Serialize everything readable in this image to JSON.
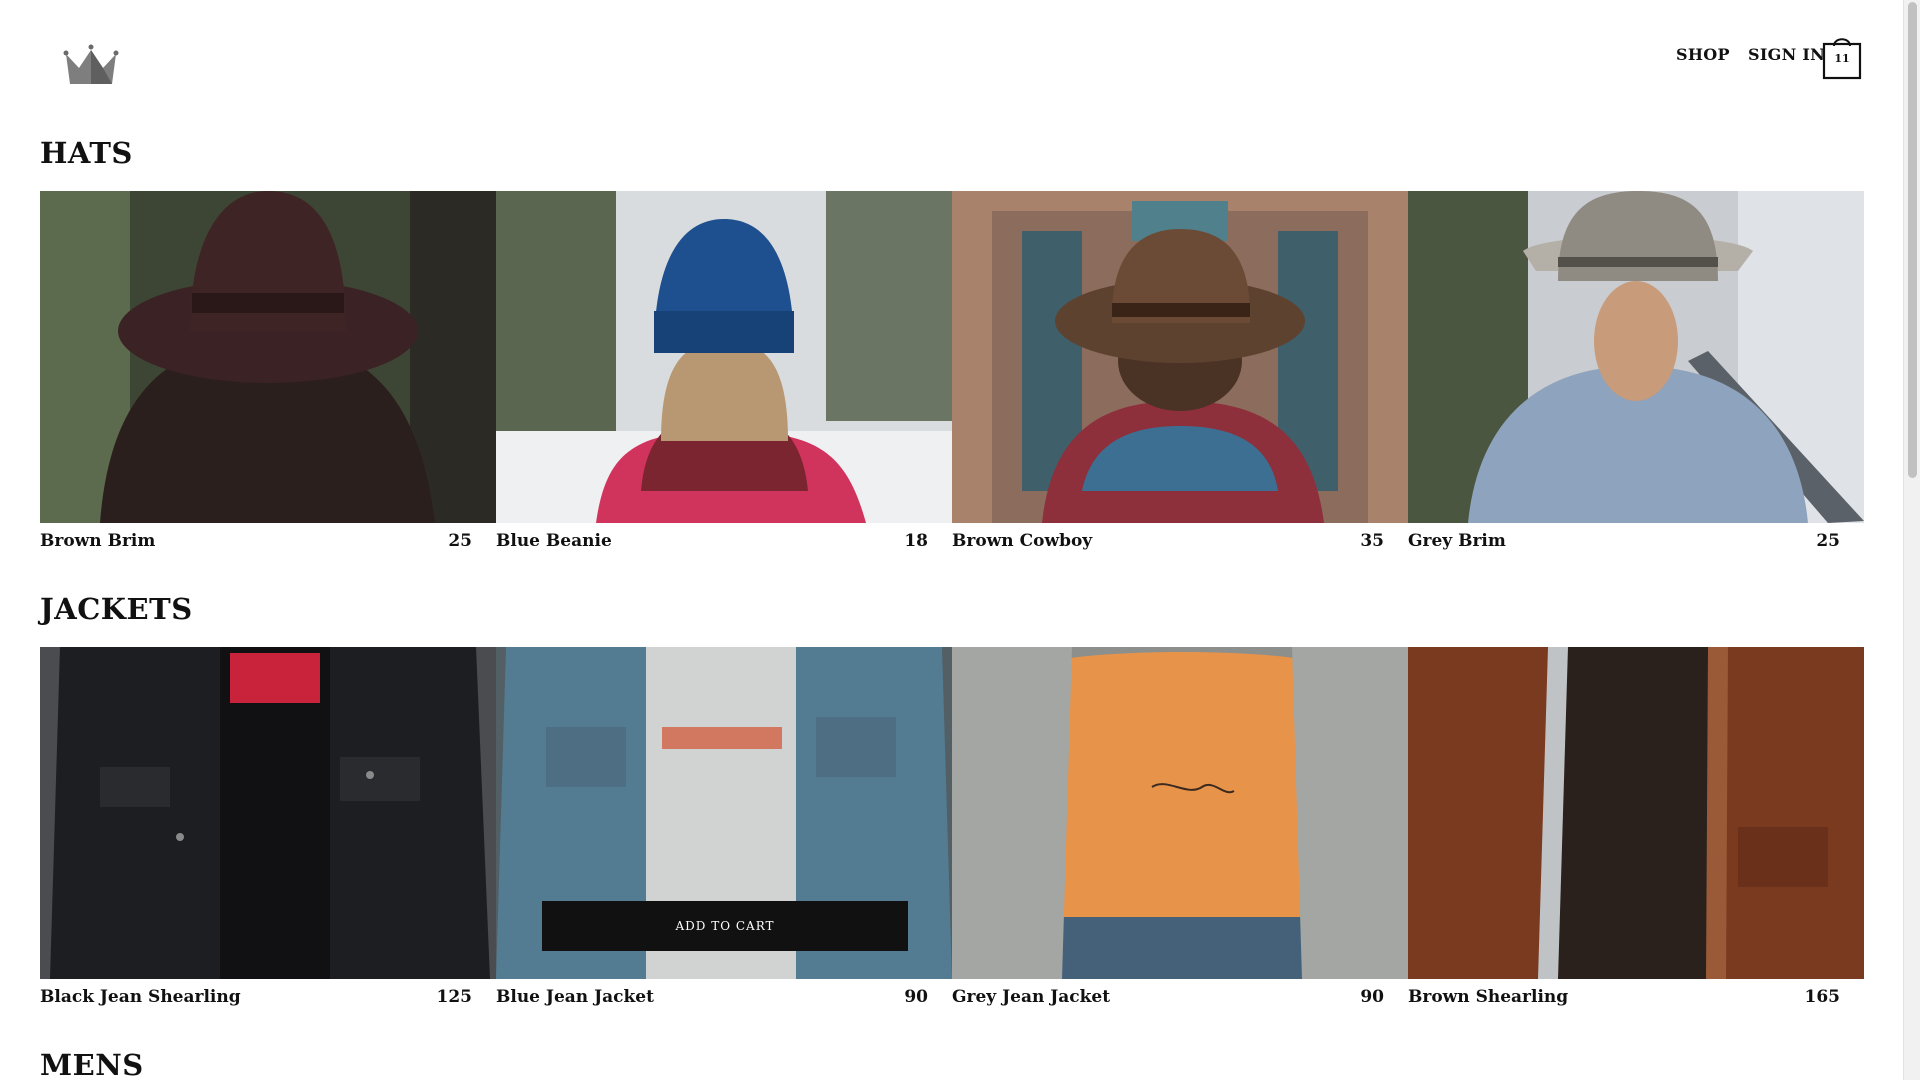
{
  "header": {
    "logo_icon": "crown-icon",
    "nav": {
      "shop_label": "SHOP",
      "signin_label": "SIGN IN"
    },
    "cart": {
      "icon": "shopping-bag-icon",
      "count": "11"
    }
  },
  "sections": [
    {
      "title": "HATS",
      "items": [
        {
          "name": "Brown Brim",
          "price": "25"
        },
        {
          "name": "Blue Beanie",
          "price": "18"
        },
        {
          "name": "Brown Cowboy",
          "price": "35"
        },
        {
          "name": "Grey Brim",
          "price": "25"
        }
      ]
    },
    {
      "title": "JACKETS",
      "items": [
        {
          "name": "Black Jean Shearling",
          "price": "125"
        },
        {
          "name": "Blue Jean Jacket",
          "price": "90",
          "hover_button": "ADD TO CART"
        },
        {
          "name": "Grey Jean Jacket",
          "price": "90"
        },
        {
          "name": "Brown Shearling",
          "price": "165"
        }
      ]
    },
    {
      "title": "MENS"
    }
  ]
}
